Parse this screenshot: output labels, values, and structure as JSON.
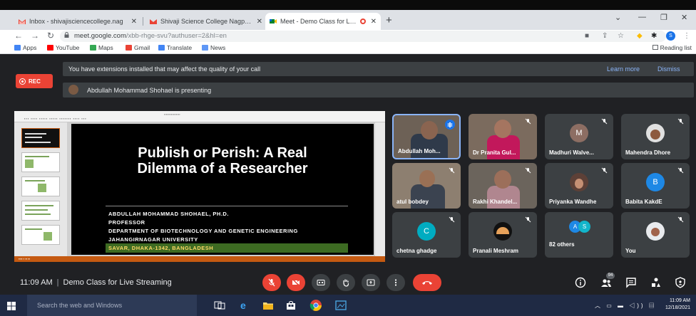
{
  "browser": {
    "tabs": [
      {
        "label": "Inbox - shivajisciencecollege.nag",
        "icon": "gmail-icon",
        "active": false
      },
      {
        "label": "Shivaji Science College Nagpur I",
        "icon": "gmail-icon",
        "active": false
      },
      {
        "label": "Meet - Demo Class for Live",
        "icon": "meet-icon",
        "active": true
      }
    ],
    "url_host": "meet.google.com",
    "url_path": "/xbb-rhge-svu?authuser=2&hl=en",
    "bookmarks": [
      "Apps",
      "YouTube",
      "Maps",
      "Gmail",
      "Translate",
      "News"
    ],
    "reading_list": "Reading list",
    "profile_initial": "S"
  },
  "meet": {
    "extension_banner": {
      "message": "You have extensions installed that may affect the quality of your call",
      "learn_more": "Learn more",
      "dismiss": "Dismiss"
    },
    "rec_label": "REC",
    "presenting_text": "Abdullah Mohammad Shohael is presenting",
    "slide": {
      "title_line1": "Publish or Perish: A Real",
      "title_line2": "Dilemma of a Researcher",
      "author": "ABDULLAH MOHAMMAD SHOHAEL, PH.D.",
      "position": "PROFESSOR",
      "department": "DEPARTMENT OF BIOTECHNOLOGY AND GENETIC ENGINEERING",
      "university": "JAHANGIRNAGAR UNIVERSITY",
      "address": "SAVAR, DHAKA-1342, BANGLADESH"
    },
    "participants": [
      {
        "name": "Abdullah Moh...",
        "type": "video",
        "speaking": true
      },
      {
        "name": "Dr Pranita Gul...",
        "type": "video",
        "muted": true
      },
      {
        "name": "Madhuri Walve...",
        "type": "avatar",
        "initial": "M",
        "color": "#8d6e63",
        "muted": true
      },
      {
        "name": "Mahendra Dhore",
        "type": "photo",
        "muted": true
      },
      {
        "name": "atul bobdey",
        "type": "video",
        "muted": true
      },
      {
        "name": "Rakhi Khandel...",
        "type": "video",
        "muted": true
      },
      {
        "name": "Priyanka Wandhe",
        "type": "photo",
        "muted": true
      },
      {
        "name": "Babita KakdE",
        "type": "avatar",
        "initial": "B",
        "color": "#1e88e5",
        "muted": true
      },
      {
        "name": "chetna ghadge",
        "type": "avatar",
        "initial": "C",
        "color": "#00acc1",
        "muted": true
      },
      {
        "name": "Pranali Meshram",
        "type": "photo",
        "muted": true
      },
      {
        "name": "82 others",
        "type": "others",
        "initials": [
          "A",
          "S"
        ]
      },
      {
        "name": "You",
        "type": "photo",
        "muted": true
      }
    ],
    "time": "11:09 AM",
    "meeting_title": "Demo Class for Live Streaming",
    "people_count": "94"
  },
  "taskbar": {
    "search_placeholder": "Search the web and Windows",
    "clock_time": "11:09 AM",
    "clock_date": "12/18/2021"
  }
}
